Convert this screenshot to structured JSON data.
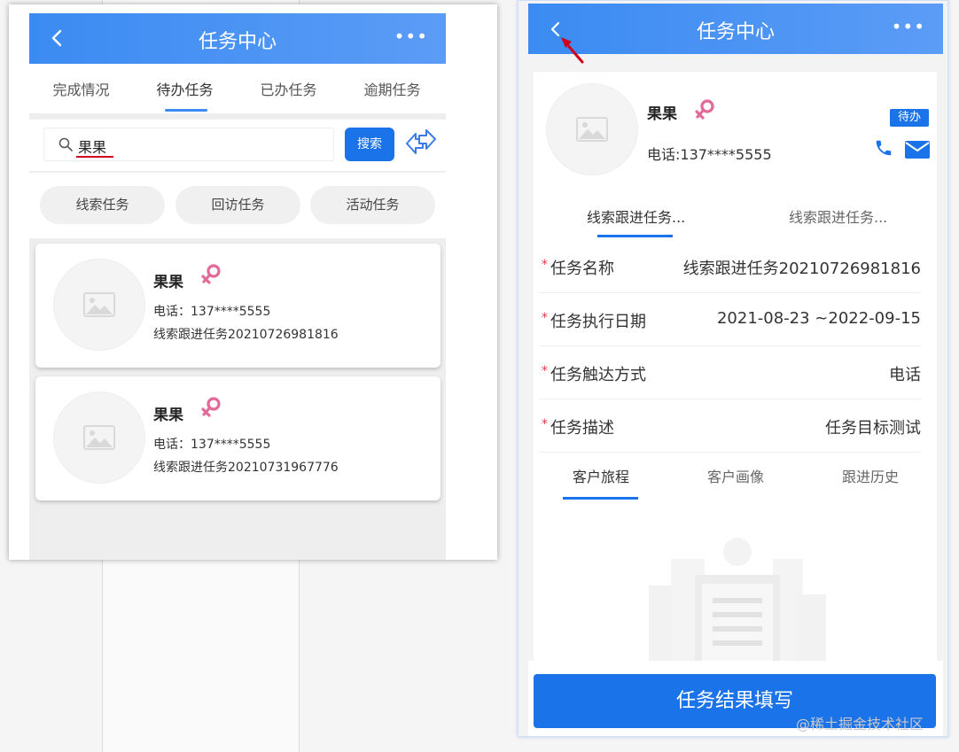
{
  "left": {
    "header": {
      "title": "任务中心",
      "more": "•••"
    },
    "tabs": [
      "完成情况",
      "待办任务",
      "已办任务",
      "逾期任务"
    ],
    "search": {
      "value": "果果",
      "button": "搜索"
    },
    "categories": [
      "线索任务",
      "回访任务",
      "活动任务"
    ],
    "cards": [
      {
        "name": "果果",
        "phone": "电话：137****5555",
        "task": "线索跟进任务20210726981816"
      },
      {
        "name": "果果",
        "phone": "电话：137****5555",
        "task": "线索跟进任务20210731967776"
      }
    ]
  },
  "right": {
    "header": {
      "title": "任务中心",
      "more": "•••"
    },
    "profile": {
      "name": "果果",
      "phone": "电话:137****5555",
      "status": "待办"
    },
    "task_tabs": [
      "线索跟进任务...",
      "线索跟进任务..."
    ],
    "fields": [
      {
        "label": "任务名称",
        "value": "线索跟进任务20210726981816"
      },
      {
        "label": "任务执行日期",
        "value": "2021-08-23 ~2022-09-15"
      },
      {
        "label": "任务触达方式",
        "value": "电话"
      },
      {
        "label": "任务描述",
        "value": "任务目标测试"
      }
    ],
    "detail_tabs": [
      "客户旅程",
      "客户画像",
      "跟进历史"
    ],
    "submit": "任务结果填写"
  },
  "watermark": "@稀土掘金技术社区",
  "colors": {
    "primary": "#1a73e8",
    "header_start": "#3b8bf2",
    "header_end": "#5b9cf6",
    "gender": "#e26a99",
    "required": "#e4393c"
  }
}
